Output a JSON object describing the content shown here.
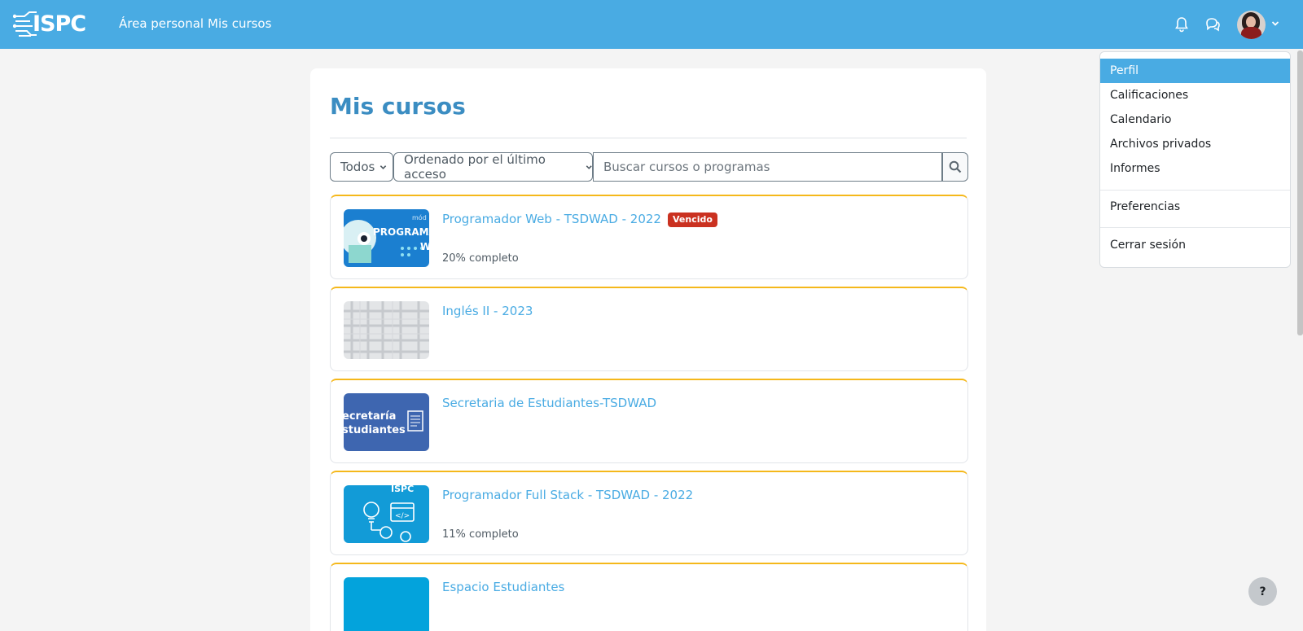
{
  "brand": {
    "logo_text": "ISPC"
  },
  "nav": {
    "home_label": "Área personal",
    "courses_label": "Mis cursos"
  },
  "page": {
    "title": "Mis cursos"
  },
  "controls": {
    "filter_value": "Todos",
    "sort_value": "Ordenado por el último acceso",
    "search_placeholder": "Buscar cursos o programas"
  },
  "courses": [
    {
      "name": "Programador Web - TSDWAD - 2022",
      "badge": "Vencido",
      "progress_value": 20,
      "progress_pct": "20%",
      "progress_word": "completo",
      "image_icon": "course-web-image"
    },
    {
      "name": "Inglés II - 2023",
      "image_icon": "course-pattern-image"
    },
    {
      "name": "Secretaria de Estudiantes-TSDWAD",
      "image_icon": "course-secretaria-image",
      "image_text_1": "ecretaría",
      "image_text_2": "studiantes"
    },
    {
      "name": "Programador Full Stack - TSDWAD - 2022",
      "progress_value": 11,
      "progress_pct": "11%",
      "progress_word": "completo",
      "image_icon": "course-fullstack-image",
      "image_text": "ISPC"
    },
    {
      "name": "Espacio Estudiantes",
      "image_icon": "course-espacio-image"
    }
  ],
  "user_menu": {
    "items": [
      "Perfil",
      "Calificaciones",
      "Calendario",
      "Archivos privados",
      "Informes",
      "Preferencias",
      "Cerrar sesión"
    ],
    "active_item": "Perfil"
  },
  "help": {
    "label": "?"
  },
  "colors": {
    "primary": "#49abe3",
    "title": "#3b8dc2",
    "accent_border": "#f5b81b",
    "badge_danger": "#ca3120"
  },
  "icons": [
    "bell-icon",
    "chat-icon",
    "chevron-down-icon",
    "search-icon",
    "help-icon"
  ]
}
